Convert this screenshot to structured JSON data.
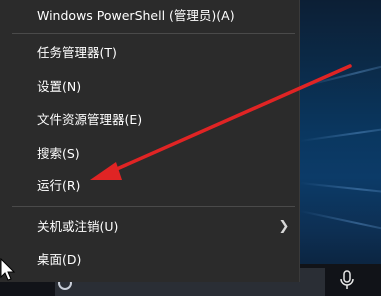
{
  "menu": {
    "items": [
      {
        "label": "Windows PowerShell (管理员)(A)"
      },
      {
        "label": "任务管理器(T)"
      },
      {
        "label": "设置(N)"
      },
      {
        "label": "文件资源管理器(E)"
      },
      {
        "label": "搜索(S)"
      },
      {
        "label": "运行(R)"
      },
      {
        "label": "关机或注销(U)",
        "has_submenu": true
      },
      {
        "label": "桌面(D)"
      }
    ]
  },
  "colors": {
    "menu_bg": "#2b2b2b",
    "menu_text": "#ffffff",
    "annotation_arrow": "#e02424",
    "desktop_blue": "#0a3760"
  },
  "icons": {
    "submenu": "chevron-right-icon",
    "microphone": "microphone-icon",
    "search": "search-icon",
    "cursor": "mouse-pointer-icon"
  }
}
